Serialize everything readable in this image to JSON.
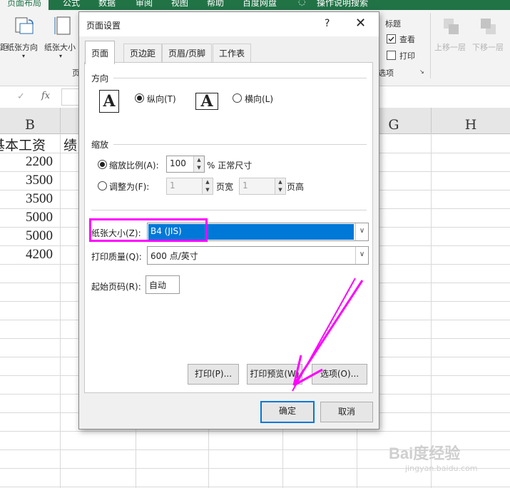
{
  "ribbon": {
    "tabs": [
      "页面布局",
      "公式",
      "数据",
      "审阅",
      "视图",
      "帮助",
      "百度网盘",
      "操作说明搜索"
    ],
    "buttons": [
      "距",
      "纸张方向",
      "纸张大小"
    ],
    "group_label_left": "页",
    "headings_group": {
      "title": "标题",
      "view": "查看",
      "print": "打印",
      "options_label": "选项"
    },
    "arrange": {
      "bring_forward": "上移一层",
      "send_backward": "下移一层"
    }
  },
  "formula_bar": {
    "fx": "fx"
  },
  "columns": [
    "B",
    "G",
    "H"
  ],
  "cells": {
    "header_b": "基本工资",
    "header_c": "绩",
    "values_b": [
      "2200",
      "3500",
      "3500",
      "5000",
      "5000",
      "4200"
    ]
  },
  "dialog": {
    "title": "页面设置",
    "help": "?",
    "close": "✕",
    "tabs": [
      "页面",
      "页边距",
      "页眉/页脚",
      "工作表"
    ],
    "orientation": {
      "label": "方向",
      "portrait": "纵向(T)",
      "landscape": "横向(L)",
      "icon_letter": "A"
    },
    "scaling": {
      "label": "缩放",
      "adjust_to": "缩放比例(A):",
      "adjust_value": "100",
      "adjust_suffix": "% 正常尺寸",
      "fit_to": "调整为(F):",
      "pages_wide": "1",
      "pages_wide_suffix": "页宽",
      "pages_tall": "1",
      "pages_tall_suffix": "页高"
    },
    "paper_size": {
      "label": "纸张大小(Z):",
      "value": "B4 (JIS)"
    },
    "print_quality": {
      "label": "打印质量(Q):",
      "value": "600 点/英寸"
    },
    "first_page_number": {
      "label": "起始页码(R):",
      "value": "自动"
    },
    "buttons": {
      "print": "打印(P)...",
      "preview": "打印预览(W)",
      "options": "选项(O)...",
      "ok": "确定",
      "cancel": "取消"
    }
  },
  "watermark": {
    "brand": "Bai度经验",
    "url": "jingyan.baidu.com"
  },
  "colors": {
    "excel_green": "#217346",
    "highlight_magenta": "#ff00ff",
    "selection_blue": "#0078d7"
  }
}
